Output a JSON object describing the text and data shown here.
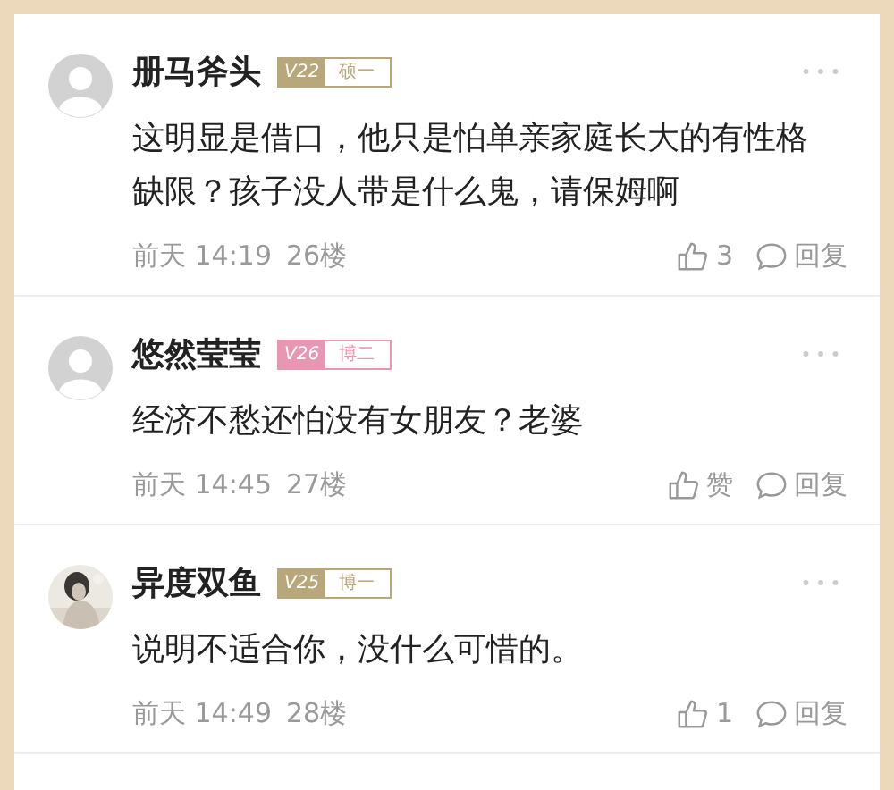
{
  "comments": [
    {
      "avatar": {
        "kind": "default"
      },
      "name": "册马斧头",
      "level": "V22",
      "rank": "硕一",
      "color": "#b9a77c",
      "text": "这明显是借口，他只是怕单亲家庭长大的有性格缺限？孩子没人带是什么鬼，请保姆啊",
      "time": "前天 14:19",
      "floor": "26楼",
      "likes": "3",
      "reply": "回复"
    },
    {
      "avatar": {
        "kind": "default"
      },
      "name": "悠然莹莹",
      "level": "V26",
      "rank": "博二",
      "color": "#e897b2",
      "text": "经济不愁还怕没有女朋友？老婆",
      "time": "前天 14:45",
      "floor": "27楼",
      "likes": "赞",
      "reply": "回复"
    },
    {
      "name": "异度双鱼",
      "level": "V25",
      "rank": "博一",
      "color": "#b9a77c",
      "text": "说明不适合你，没什么可惜的。",
      "time": "前天 14:49",
      "floor": "28楼",
      "likes": "1",
      "reply": "回复"
    }
  ]
}
